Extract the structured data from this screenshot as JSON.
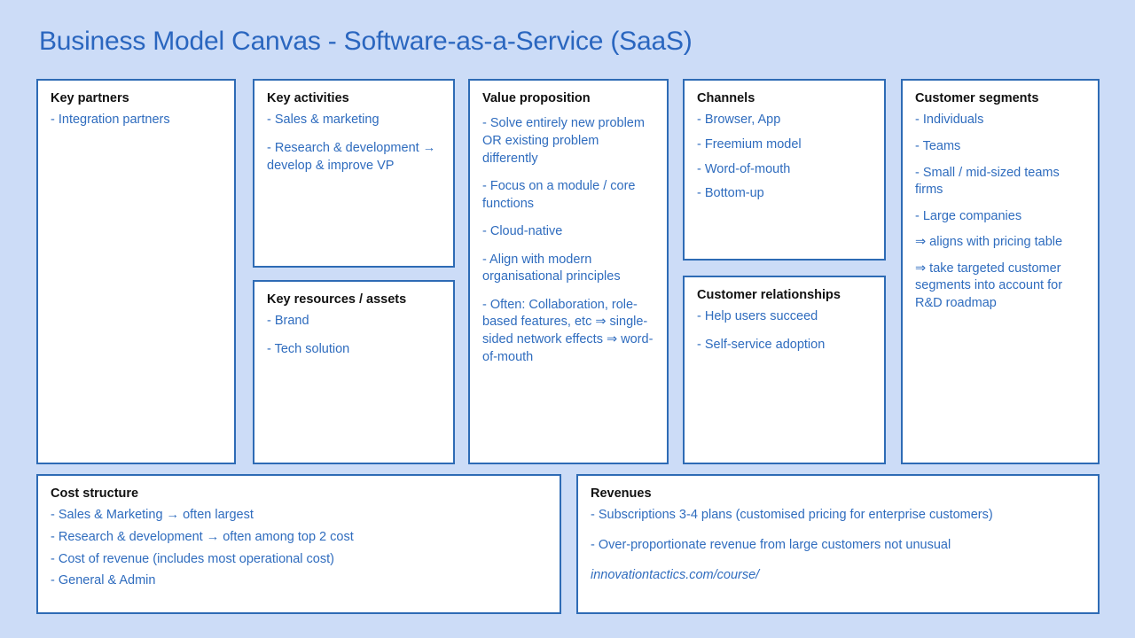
{
  "title": "Business Model Canvas - Software-as-a-Service (SaaS)",
  "colors": {
    "background": "#ccdcf7",
    "box_background": "#ffffff",
    "box_border": "#2e6bb5",
    "heading_text": "#111111",
    "body_text": "#2f6cbe",
    "title_text": "#2a66bf"
  },
  "blocks": {
    "key_partners": {
      "title": "Key partners",
      "lines": [
        "- Integration partners"
      ]
    },
    "key_activities": {
      "title": "Key activities",
      "lines": [
        "- Sales & marketing",
        "- Research & development → develop & improve VP"
      ]
    },
    "key_resources": {
      "title": "Key resources / assets",
      "lines": [
        "- Brand",
        "- Tech solution"
      ]
    },
    "value_proposition": {
      "title": "Value proposition",
      "lines": [
        "- Solve entirely new problem OR existing problem differently",
        "- Focus on a module / core functions",
        "- Cloud-native",
        "- Align with modern organisational principles",
        "- Often: Collaboration, role-based features, etc ⇒ single-sided network effects ⇒ word-of-mouth"
      ]
    },
    "channels": {
      "title": "Channels",
      "lines": [
        "- Browser, App",
        "- Freemium model",
        "- Word-of-mouth",
        "- Bottom-up"
      ]
    },
    "customer_relationships": {
      "title": "Customer relationships",
      "lines": [
        "- Help users succeed",
        "- Self-service adoption"
      ]
    },
    "customer_segments": {
      "title": "Customer segments",
      "lines": [
        "- Individuals",
        "- Teams",
        "- Small / mid-sized teams firms",
        "- Large companies",
        "⇒ aligns with pricing table",
        "⇒ take targeted customer segments into account for R&D roadmap"
      ]
    },
    "cost_structure": {
      "title": "Cost structure",
      "lines": [
        "- Sales & Marketing → often largest",
        "- Research & development → often among top 2 cost",
        "- Cost of revenue (includes most operational cost)",
        "- General & Admin"
      ]
    },
    "revenues": {
      "title": "Revenues",
      "lines": [
        "- Subscriptions 3-4 plans (customised pricing for enterprise customers)",
        "- Over-proportionate revenue from large customers not unusual"
      ],
      "footer_link": "innovationtactics.com/course/"
    }
  }
}
